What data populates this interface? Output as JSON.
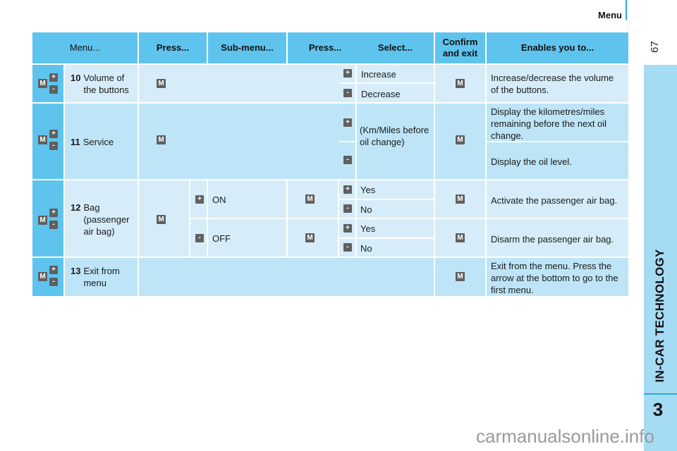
{
  "page": {
    "section_title": "Menu",
    "page_number": "67",
    "chapter_title": "IN-CAR TECHNOLOGY",
    "chapter_number": "3",
    "watermark": "carmanualsonline.info"
  },
  "table": {
    "headers": [
      "Menu...",
      "Press...",
      "Sub-menu...",
      "Press...",
      "Select...",
      "Confirm\nand exit",
      "Enables you to..."
    ],
    "header_confirm_line1": "Confirm",
    "header_confirm_line2": "and exit",
    "keys": {
      "menu": "M",
      "plus": "+",
      "minus": "-"
    },
    "rows": [
      {
        "number": "10",
        "label_line1": "Volume of",
        "label_line2": "the buttons",
        "selections": [
          {
            "key": "+",
            "label": "Increase"
          },
          {
            "key": "-",
            "label": "Decrease"
          }
        ],
        "description": "Increase/decrease the volume of the buttons."
      },
      {
        "number": "11",
        "label_line1": "Service",
        "select_text": "(Km/Miles before oil change)",
        "selections": [
          {
            "key": "+",
            "description": "Display the kilometres/miles remaining before the next oil change."
          },
          {
            "key": "-",
            "description": "Display the oil level."
          }
        ]
      },
      {
        "number": "12",
        "label_line1": "Bag",
        "label_line2": "(passenger",
        "label_line3": "air bag)",
        "submenus": [
          {
            "key": "+",
            "label": "ON",
            "selections": [
              {
                "key": "+",
                "label": "Yes"
              },
              {
                "key": "-",
                "label": "No"
              }
            ],
            "description": "Activate the passenger air bag."
          },
          {
            "key": "-",
            "label": "OFF",
            "selections": [
              {
                "key": "+",
                "label": "Yes"
              },
              {
                "key": "-",
                "label": "No"
              }
            ],
            "description": "Disarm the passenger air bag."
          }
        ]
      },
      {
        "number": "13",
        "label_line1": "Exit from",
        "label_line2": "menu",
        "description": "Exit from the menu. Press the arrow at the bottom to go to the first menu."
      }
    ]
  },
  "colors": {
    "header_bg": "#5ec4ee",
    "row_light": "#d6edf9",
    "row_mid": "#bde5f7",
    "sidebar": "#a6dbf4",
    "accent_line": "#2aa7df",
    "key_bg": "#606060"
  }
}
